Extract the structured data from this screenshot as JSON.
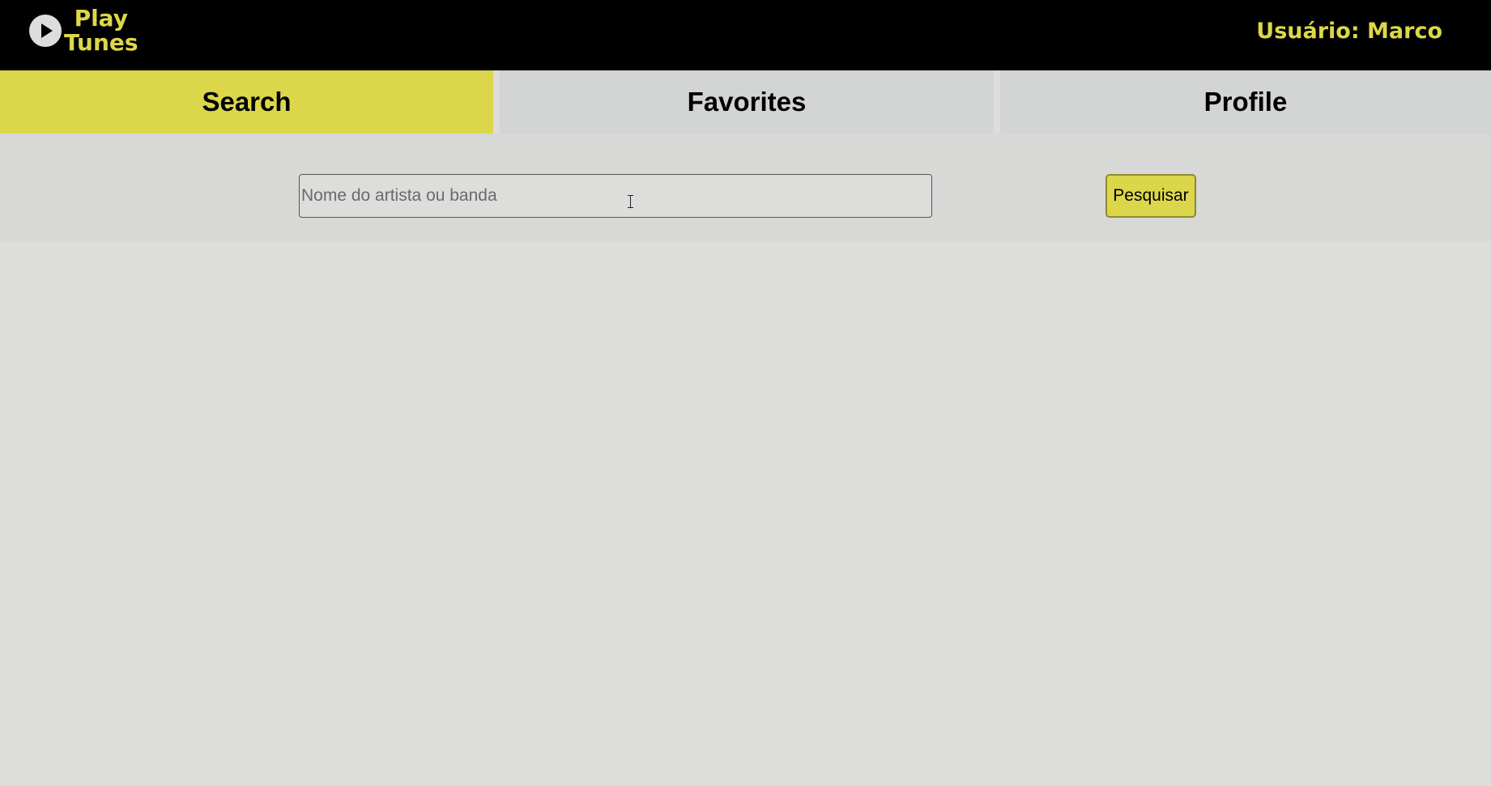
{
  "header": {
    "logo": {
      "icon": "play-circle-icon",
      "line1": "Play",
      "line2": "Tunes"
    },
    "user_label": "Usuário: Marco"
  },
  "tabs": [
    {
      "label": "Search",
      "active": true
    },
    {
      "label": "Favorites",
      "active": false
    },
    {
      "label": "Profile",
      "active": false
    }
  ],
  "search": {
    "placeholder": "Nome do artista ou banda",
    "value": "",
    "button_label": "Pesquisar"
  },
  "colors": {
    "accent": "#dcd74a",
    "header_bg": "#000000",
    "page_bg": "#dddddc",
    "tab_bg": "#d3d4d4"
  }
}
